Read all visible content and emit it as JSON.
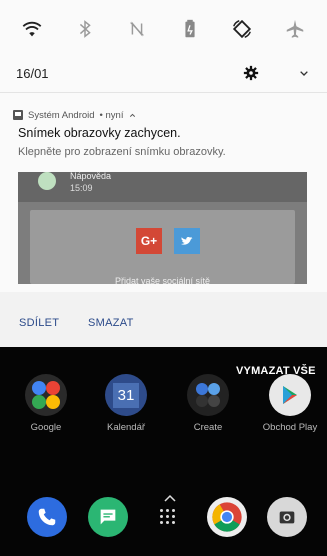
{
  "quick_settings": {
    "tiles": [
      {
        "name": "wifi-icon"
      },
      {
        "name": "bluetooth-icon"
      },
      {
        "name": "nfc-icon"
      },
      {
        "name": "battery-saver-icon"
      },
      {
        "name": "auto-rotate-icon"
      },
      {
        "name": "airplane-mode-icon"
      }
    ]
  },
  "status": {
    "date": "16/01"
  },
  "notification": {
    "app_name": "Systém Android",
    "time": "• nyní",
    "title": "Snímek obrazovky zachycen.",
    "text": "Klepněte pro zobrazení snímku obrazovky.",
    "preview": {
      "name": "Nápověda",
      "time": "15:09",
      "gplus": "G+",
      "share_text": "Přidat vaše sociální sítě"
    },
    "actions": {
      "share": "SDÍLET",
      "delete": "SMAZAT"
    }
  },
  "home": {
    "clear_all": "VYMAZAT VŠE",
    "apps": [
      {
        "label": "Google"
      },
      {
        "label": "Kalendář"
      },
      {
        "label": "Create"
      },
      {
        "label": "Obchod Play"
      }
    ],
    "calendar_day": "31"
  },
  "colors": {
    "action_text": "#2b4a8a",
    "shade_bg": "#fafafa"
  }
}
